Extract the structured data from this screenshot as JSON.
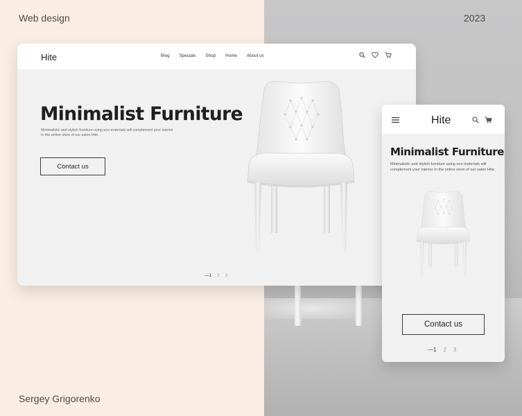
{
  "frame": {
    "top_left_label": "Web design",
    "top_right_label": "2023",
    "bottom_left_label": "Sergey Grigorenko",
    "colors": {
      "left_bg": "#faeee4",
      "right_bg": "#c4c4c5",
      "card_bg": "#f1f1f1",
      "text": "#1f1f1f"
    }
  },
  "desktop": {
    "logo": "Hite",
    "nav": [
      "Blog",
      "Specials",
      "Shop",
      "Home",
      "About us"
    ],
    "icons": [
      "search-icon",
      "heart-icon",
      "cart-icon"
    ],
    "headline": "Minimalist Furniture",
    "description_line1": "Minimalistic and stylish furniture using eco-materials will complement your interior",
    "description_line2": "In the online store of our salon Hite.",
    "cta_label": "Contact us",
    "pager": {
      "active": "—1",
      "pages": [
        "2",
        "3"
      ]
    }
  },
  "mobile": {
    "logo": "Hite",
    "icons": [
      "menu-icon",
      "search-icon",
      "cart-icon"
    ],
    "headline": "Minimalist Furniture",
    "description": "Minimalistic and stylish furniture using eco-materials will complement your interior In the online store of our salon Hite.",
    "cta_label": "Contact us",
    "pager": {
      "active": "—1",
      "pages": [
        "2",
        "3"
      ]
    }
  }
}
